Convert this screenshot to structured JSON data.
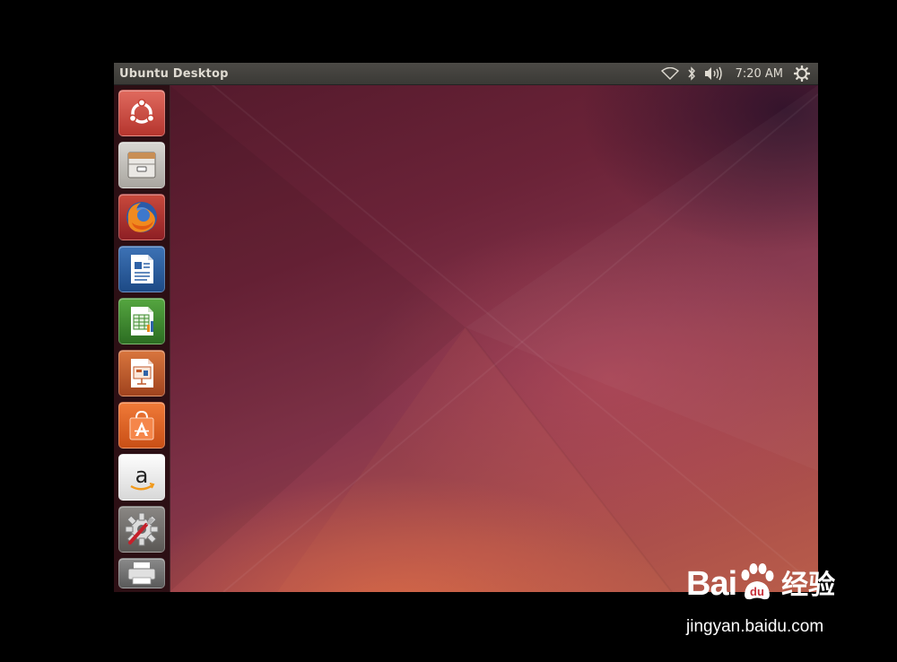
{
  "window": {
    "title": "Ubuntu Desktop"
  },
  "topbar": {
    "indicators": [
      "wifi-icon",
      "bluetooth-icon",
      "volume-icon"
    ],
    "clock": "7:20 AM",
    "session_icon": "gear-icon"
  },
  "launcher": {
    "items": [
      {
        "name": "Dash Home",
        "icon": "ubuntu-logo-icon"
      },
      {
        "name": "Files",
        "icon": "file-cabinet-icon"
      },
      {
        "name": "Firefox Web Browser",
        "icon": "firefox-icon"
      },
      {
        "name": "LibreOffice Writer",
        "icon": "writer-document-icon"
      },
      {
        "name": "LibreOffice Calc",
        "icon": "calc-spreadsheet-icon"
      },
      {
        "name": "LibreOffice Impress",
        "icon": "impress-presentation-icon"
      },
      {
        "name": "Ubuntu Software Center",
        "icon": "software-center-bag-icon"
      },
      {
        "name": "Amazon",
        "icon": "amazon-icon"
      },
      {
        "name": "System Settings",
        "icon": "system-settings-icon"
      },
      {
        "name": "Printer",
        "icon": "printer-icon"
      }
    ]
  },
  "watermark": {
    "brand": "Bai",
    "brand_cn": "经验",
    "url": "jingyan.baidu.com"
  },
  "colors": {
    "topbar": "#3f3e3a",
    "launcher": "#301016",
    "ubuntu_orange": "#dd4814",
    "wallpaper_dark": "#541a2c",
    "wallpaper_light": "#b95d49"
  }
}
